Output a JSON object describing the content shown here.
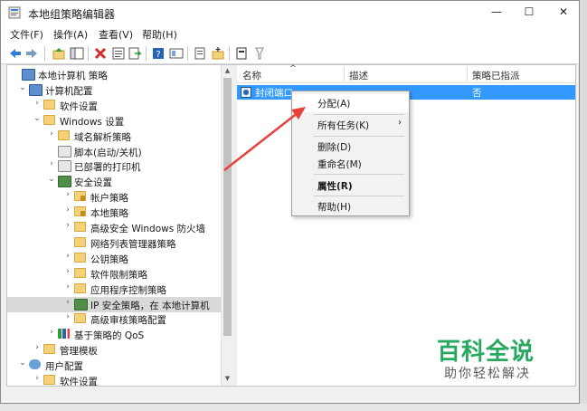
{
  "window": {
    "title": "本地组策略编辑器",
    "minimize": "—",
    "maximize": "☐",
    "close": "✕"
  },
  "menu": [
    "文件(F)",
    "操作(A)",
    "查看(V)",
    "帮助(H)"
  ],
  "toolbar_icons": [
    "back-icon",
    "forward-icon",
    "up-icon",
    "show-hide-tree-icon",
    "delete-icon",
    "properties-icon",
    "export-icon",
    "help-icon",
    "view-icon",
    "policy-icon",
    "add-icon",
    "assign-icon",
    "filter-icon"
  ],
  "tree": [
    {
      "label": "本地计算机 策略",
      "arrow": "",
      "level": 0,
      "icon": "policy-icon"
    },
    {
      "label": "计算机配置",
      "arrow": "⌄",
      "level": 1,
      "icon": "computer-icon"
    },
    {
      "label": "软件设置",
      "arrow": "›",
      "level": 2,
      "icon": "folder-icon"
    },
    {
      "label": "Windows 设置",
      "arrow": "⌄",
      "level": 2,
      "icon": "folder-icon"
    },
    {
      "label": "域名解析策略",
      "arrow": "›",
      "level": 3,
      "icon": "folder-icon"
    },
    {
      "label": "脚本(启动/关机)",
      "arrow": "",
      "level": 3,
      "icon": "script-icon"
    },
    {
      "label": "已部署的打印机",
      "arrow": "›",
      "level": 3,
      "icon": "printer-icon"
    },
    {
      "label": "安全设置",
      "arrow": "⌄",
      "level": 3,
      "icon": "security-icon"
    },
    {
      "label": "帐户策略",
      "arrow": "›",
      "level": 4,
      "icon": "folder-lock-icon"
    },
    {
      "label": "本地策略",
      "arrow": "›",
      "level": 4,
      "icon": "folder-lock-icon"
    },
    {
      "label": "高级安全 Windows 防火墙",
      "arrow": "›",
      "level": 4,
      "icon": "folder-icon"
    },
    {
      "label": "网络列表管理器策略",
      "arrow": "",
      "level": 4,
      "icon": "folder-icon"
    },
    {
      "label": "公钥策略",
      "arrow": "›",
      "level": 4,
      "icon": "folder-icon"
    },
    {
      "label": "软件限制策略",
      "arrow": "›",
      "level": 4,
      "icon": "folder-icon"
    },
    {
      "label": "应用程序控制策略",
      "arrow": "›",
      "level": 4,
      "icon": "folder-icon"
    },
    {
      "label": "IP 安全策略，在 本地计算机",
      "arrow": "›",
      "level": 4,
      "icon": "ip-security-icon",
      "selected": true
    },
    {
      "label": "高级审核策略配置",
      "arrow": "›",
      "level": 4,
      "icon": "folder-icon"
    },
    {
      "label": "基于策略的 QoS",
      "arrow": "›",
      "level": 3,
      "icon": "qos-chart-icon"
    },
    {
      "label": "管理模板",
      "arrow": "›",
      "level": 2,
      "icon": "folder-icon"
    },
    {
      "label": "用户配置",
      "arrow": "⌄",
      "level": 1,
      "icon": "user-icon"
    },
    {
      "label": "软件设置",
      "arrow": "›",
      "level": 2,
      "icon": "folder-icon"
    }
  ],
  "list": {
    "columns": [
      "名称",
      "描述",
      "策略已指派"
    ],
    "sort_indicator": "^",
    "rows": [
      {
        "name": "封闭端口",
        "description": "",
        "assigned": "否"
      }
    ]
  },
  "context_menu": [
    {
      "label": "分配(A)",
      "bold": false,
      "submenu": false,
      "hover": true
    },
    {
      "label": "所有任务(K)",
      "bold": false,
      "submenu": true
    },
    {
      "label": "删除(D)",
      "bold": false,
      "submenu": false
    },
    {
      "label": "重命名(M)",
      "bold": false,
      "submenu": false
    },
    {
      "label": "属性(R)",
      "bold": true,
      "submenu": false
    },
    {
      "label": "帮助(H)",
      "bold": false,
      "submenu": false
    }
  ],
  "watermark": {
    "title": "百科全说",
    "subtitle": "助你轻松解决"
  },
  "colors": {
    "selection": "#3399ff",
    "arrow": "#e8403a",
    "watermark": "#27a85f"
  }
}
